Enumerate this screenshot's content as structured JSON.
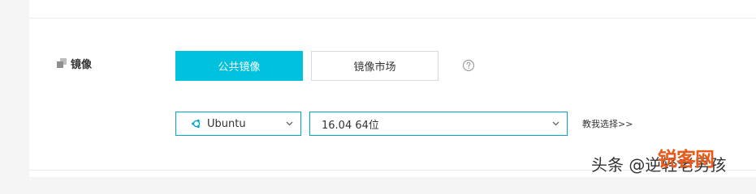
{
  "image_section": {
    "label": "镜像",
    "label_icon": "stack-icon",
    "tabs": [
      {
        "label": "公共镜像",
        "active": true
      },
      {
        "label": "镜像市场",
        "active": false
      }
    ],
    "help_icon": "question-circle-icon"
  },
  "os_select": {
    "icon": "ubuntu-icon",
    "value": "Ubuntu",
    "chevron_icon": "chevron-down-icon"
  },
  "version_select": {
    "value": "16.04 64位",
    "chevron_icon": "chevron-down-icon"
  },
  "help_link": {
    "text": "教我选择>>"
  },
  "watermark": {
    "text": "头条 @逆轻老男孩",
    "logo_text": "锐客网"
  },
  "colors": {
    "accent": "#00c1de",
    "select_border": "#00a6c8",
    "text": "#333333",
    "watermark_logo": "#e85b1d"
  }
}
